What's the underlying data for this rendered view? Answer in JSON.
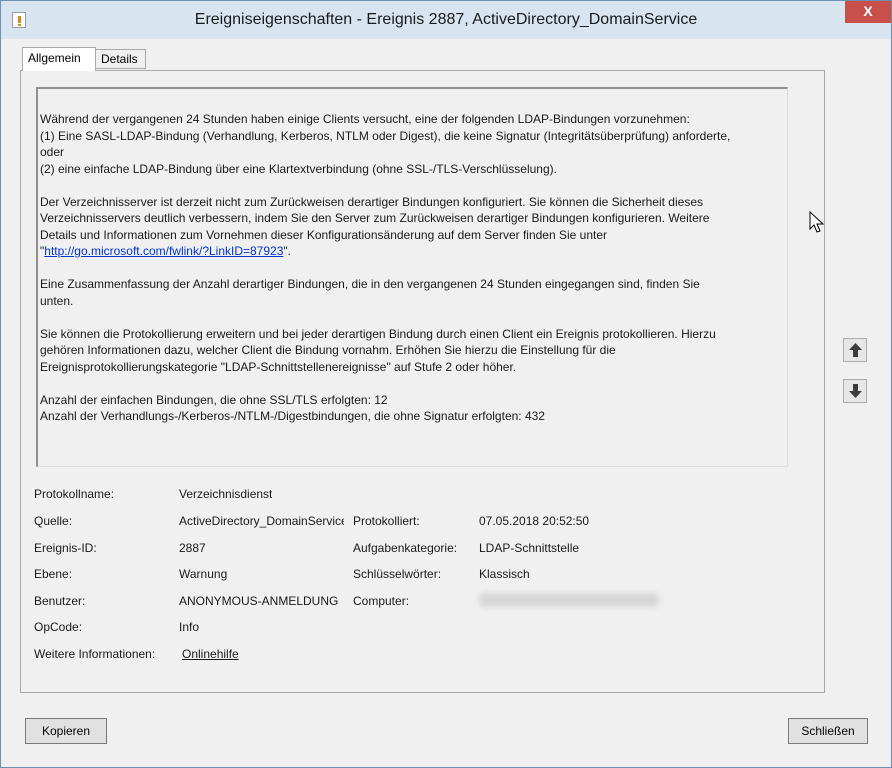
{
  "window": {
    "title": "Ereigniseigenschaften - Ereignis 2887, ActiveDirectory_DomainService",
    "close_glyph": "X"
  },
  "tabs": [
    {
      "label": "Allgemein",
      "active": true
    },
    {
      "label": "Details",
      "active": false
    }
  ],
  "description": {
    "p1_lines": [
      "Während der vergangenen 24 Stunden haben einige Clients versucht, eine der folgenden LDAP-Bindungen vorzunehmen:",
      "(1) Eine SASL-LDAP-Bindung (Verhandlung, Kerberos, NTLM oder Digest), die keine Signatur (Integritätsüberprüfung) anforderte,",
      "oder",
      "(2) eine einfache LDAP-Bindung über eine Klartextverbindung (ohne SSL-/TLS-Verschlüsselung)."
    ],
    "p2_lines": [
      "Der Verzeichnisserver ist derzeit nicht zum Zurückweisen derartiger Bindungen konfiguriert. Sie können die Sicherheit dieses",
      "Verzeichnisservers deutlich verbessern, indem Sie den Server zum Zurückweisen derartiger Bindungen konfigurieren. Weitere",
      "Details und Informationen zum Vornehmen dieser Konfigurationsänderung auf dem Server finden Sie unter"
    ],
    "p2_link_prefix": "\"",
    "p2_link": "http://go.microsoft.com/fwlink/?LinkID=87923",
    "p2_link_suffix": "\".",
    "p3_lines": [
      "Eine Zusammenfassung der Anzahl derartiger Bindungen, die in den vergangenen 24 Stunden eingegangen sind, finden Sie",
      "unten."
    ],
    "p4_lines": [
      "Sie können die Protokollierung erweitern und bei jeder derartigen Bindung durch einen Client ein Ereignis protokollieren.  Hierzu",
      "gehören Informationen dazu, welcher Client die Bindung vornahm. Erhöhen Sie hierzu die Einstellung für die",
      "Ereignisprotokollierungskategorie \"LDAP-Schnittstellenereignisse\" auf Stufe 2 oder höher."
    ],
    "p5_lines": [
      "Anzahl der einfachen Bindungen, die ohne SSL/TLS erfolgten: 12",
      "Anzahl der Verhandlungs-/Kerberos-/NTLM-/Digestbindungen, die ohne Signatur erfolgten: 432"
    ]
  },
  "fields": {
    "log_name_label": "Protokollname:",
    "log_name_value": "Verzeichnisdienst",
    "source_label": "Quelle:",
    "source_value": "ActiveDirectory_DomainService",
    "logged_label": "Protokolliert:",
    "logged_value": "07.05.2018 20:52:50",
    "event_id_label": "Ereignis-ID:",
    "event_id_value": "2887",
    "task_category_label": "Aufgabenkategorie:",
    "task_category_value": "LDAP-Schnittstelle",
    "level_label": "Ebene:",
    "level_value": "Warnung",
    "keywords_label": "Schlüsselwörter:",
    "keywords_value": "Klassisch",
    "user_label": "Benutzer:",
    "user_value": "ANONYMOUS-ANMELDUNG",
    "computer_label": "Computer:",
    "opcode_label": "OpCode:",
    "opcode_value": "Info",
    "more_info_label": "Weitere Informationen:",
    "more_info_link": "Onlinehilfe"
  },
  "buttons": {
    "copy": "Kopieren",
    "close": "Schließen"
  },
  "icons": {
    "up": "arrow-up-icon",
    "down": "arrow-down-icon",
    "cursor": "mouse-cursor-icon"
  }
}
